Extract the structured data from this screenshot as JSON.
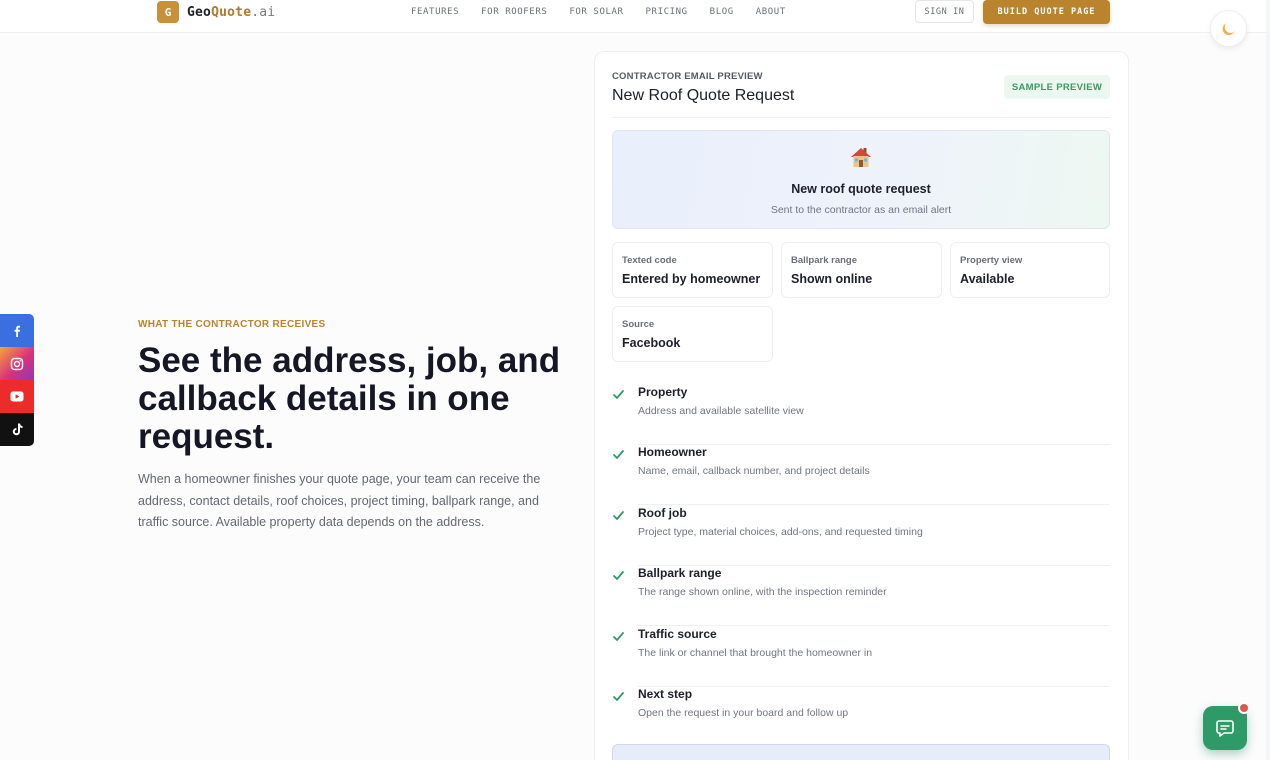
{
  "header": {
    "logo_badge": "G",
    "logo_part1": "Geo",
    "logo_part2": "Quote",
    "logo_part3": ".ai",
    "nav": [
      "FEATURES",
      "FOR ROOFERS",
      "FOR SOLAR",
      "PRICING",
      "BLOG",
      "ABOUT"
    ],
    "sign_in": "SIGN IN",
    "cta": "BUILD QUOTE PAGE",
    "theme_toggle_icon": "moon-icon"
  },
  "social": [
    "facebook-icon",
    "instagram-icon",
    "youtube-icon",
    "tiktok-icon"
  ],
  "hero": {
    "eyebrow": "WHAT THE CONTRACTOR RECEIVES",
    "headline": "See the address, job, and callback details in one request.",
    "body": "When a homeowner finishes your quote page, your team can receive the address, contact details, roof choices, project timing, ballpark range, and traffic source. Available property data depends on the address."
  },
  "card": {
    "eyebrow": "CONTRACTOR EMAIL PREVIEW",
    "title": "New Roof Quote Request",
    "badge": "SAMPLE PREVIEW",
    "alert": {
      "title": "New roof quote request",
      "subtitle": "Sent to the contractor as an email alert"
    },
    "stats": [
      {
        "label": "Texted code",
        "value": "Entered by homeowner"
      },
      {
        "label": "Ballpark range",
        "value": "Shown online"
      },
      {
        "label": "Property view",
        "value": "Available"
      },
      {
        "label": "Source",
        "value": "Facebook"
      }
    ],
    "checklist": [
      {
        "title": "Property",
        "desc": "Address and available satellite view"
      },
      {
        "title": "Homeowner",
        "desc": "Name, email, callback number, and project details"
      },
      {
        "title": "Roof job",
        "desc": "Project type, material choices, add-ons, and requested timing"
      },
      {
        "title": "Ballpark range",
        "desc": "The range shown online, with the inspection reminder"
      },
      {
        "title": "Traffic source",
        "desc": "The link or channel that brought the homeowner in"
      },
      {
        "title": "Next step",
        "desc": "Open the request in your board and follow up"
      }
    ],
    "bottom": {
      "title": "",
      "subtitle": ""
    }
  },
  "colors": {
    "accent": "#b9842d",
    "success": "#2e9a67",
    "text": "#1d1f2b"
  }
}
